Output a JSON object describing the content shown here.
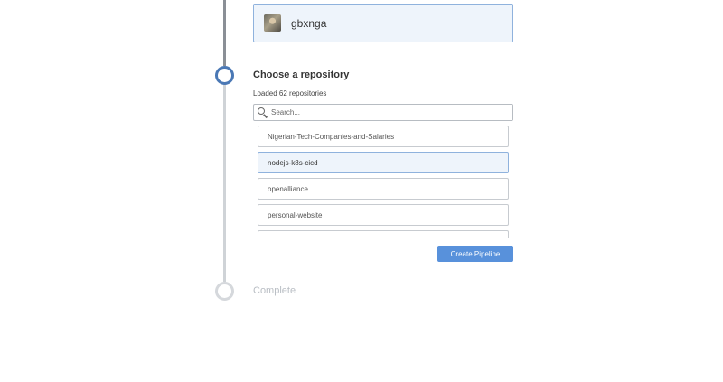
{
  "org": {
    "name": "gbxnga"
  },
  "step": {
    "title": "Choose a repository",
    "loaded_text": "Loaded 62 repositories"
  },
  "search": {
    "placeholder": "Search..."
  },
  "repos": [
    {
      "name": "Nigerian-Tech-Companies-and-Salaries",
      "selected": false
    },
    {
      "name": "nodejs-k8s-cicd",
      "selected": true
    },
    {
      "name": "openalliance",
      "selected": false
    },
    {
      "name": "personal-website",
      "selected": false
    },
    {
      "name": "",
      "selected": false
    }
  ],
  "actions": {
    "create_label": "Create Pipeline"
  },
  "next_step": {
    "label": "Complete"
  },
  "colors": {
    "accent": "#5891db",
    "active_node": "#4a78b5",
    "selected_bg": "#eef4fb"
  }
}
